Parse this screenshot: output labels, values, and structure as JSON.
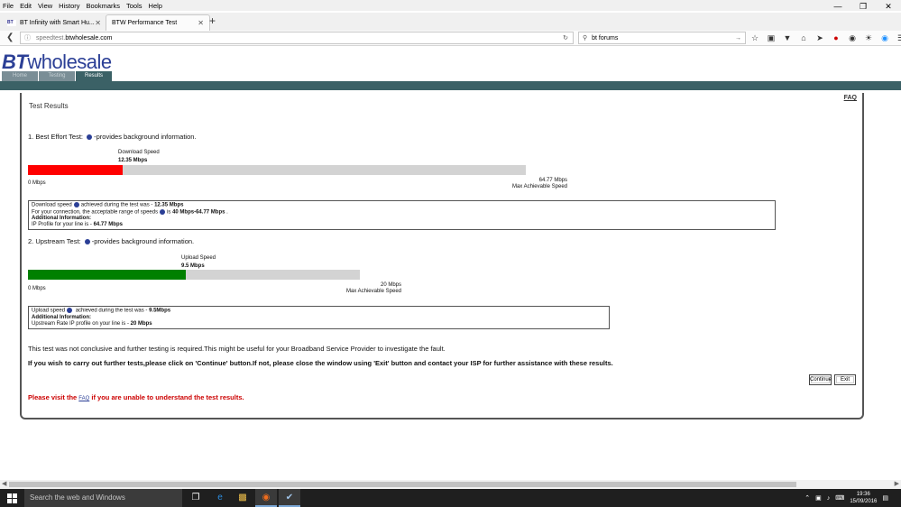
{
  "menu": [
    "File",
    "Edit",
    "View",
    "History",
    "Bookmarks",
    "Tools",
    "Help"
  ],
  "tabs": [
    {
      "favicon": "BT",
      "label": "BT Infinity with Smart Hu...",
      "active": false
    },
    {
      "favicon": "",
      "label": "BTW Performance Test",
      "active": true
    }
  ],
  "url": {
    "host_dim": "speedtest.",
    "host": "btwholesale.com"
  },
  "search": {
    "value": "bt forums"
  },
  "site": {
    "logo_bt": "BT",
    "logo_rest": "wholesale",
    "tabs": [
      "Home",
      "Testing",
      "Results"
    ],
    "band_color": "#3b6166"
  },
  "panel": {
    "faq": "FAQ",
    "title": "Test Results",
    "best_effort": {
      "heading_prefix": "1. Best Effort Test:",
      "heading_suffix": "-provides background information.",
      "speed_caption": "Download Speed",
      "speed_value": "12.35 Mbps",
      "speed_mbps": 12.35,
      "max_mbps": 64.77,
      "bar_color": "#ff0000",
      "min_label": "0 Mbps",
      "max_label_1": "64.77 Mbps",
      "max_label_2": "Max Achievable Speed",
      "box": {
        "line1_a": "Download speed",
        "line1_b": "achieved during the test was - ",
        "line1_val": "12.35 Mbps",
        "line2_a": "For your connection, the acceptable range of speeds",
        "line2_b": "is ",
        "line2_val": "40 Mbps-64.77 Mbps",
        "line2_end": " .",
        "line3": "Additional Information:",
        "line4_a": "IP Profile for your line is - ",
        "line4_val": "64.77 Mbps"
      }
    },
    "upstream": {
      "heading_prefix": "2. Upstream Test:",
      "heading_suffix": "-provides background information.",
      "speed_caption": "Upload Speed",
      "speed_value": "9.5 Mbps",
      "speed_mbps": 9.5,
      "max_mbps": 20,
      "bar_color": "#008000",
      "min_label": "0 Mbps",
      "max_label_1": "20 Mbps",
      "max_label_2": "Max Achievable Speed",
      "box": {
        "line1_a": "Upload speed",
        "line1_b": " achieved during the test was - ",
        "line1_val": "9.5Mbps",
        "line2": "Additional Information:",
        "line3_a": "Upstream Rate IP profile on your line is - ",
        "line3_val": "20 Mbps"
      }
    },
    "message1": "This test was not conclusive and further testing is required.This might be useful for your Broadband Service Provider to investigate the fault.",
    "message2": "If you wish to carry out further tests,please click on 'Continue' button.If not, please close the window using 'Exit' button and contact your ISP for further assistance with these results.",
    "continue_label": "Continue",
    "exit_label": "Exit",
    "visit_prefix": "Please visit the ",
    "visit_link": "FAQ",
    "visit_suffix": " if you are unable to understand the test results."
  },
  "taskbar": {
    "search_placeholder": "Search the web and Windows",
    "time": "19:36",
    "date": "15/09/2016"
  }
}
